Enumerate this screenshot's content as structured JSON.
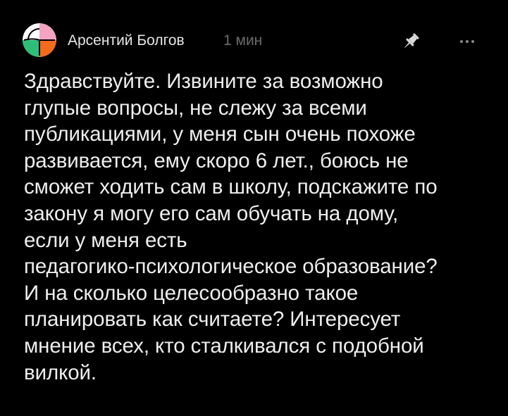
{
  "comment": {
    "author": "Арсентий Болгов",
    "time": "1 мин",
    "body": "Здравствуйте. Извините за возможно\nглупые вопросы, не слежу за всеми\nпубликациями, у меня сын очень похоже\nразвивается, ему скоро 6 лет., боюсь не\nсможет ходить сам в школу, подскажите по\nзакону я могу его сам обучать на дому,\nесли у меня есть\nпедагогико-психологическое образование?\nИ на сколько целесообразно такое\nпланировать как считаете? Интересует\nмнение всех, кто сталкивался с подобной\nвилкой.",
    "avatar_colors": [
      "#2fbe78",
      "#f26a1b",
      "#ffffff",
      "#f4a3c0"
    ],
    "icons": {
      "pin": "pin-icon",
      "more": "more-dots-icon"
    }
  },
  "colors": {
    "background": "#000000",
    "text": "#eeeeee",
    "muted": "#6b6b6b"
  }
}
